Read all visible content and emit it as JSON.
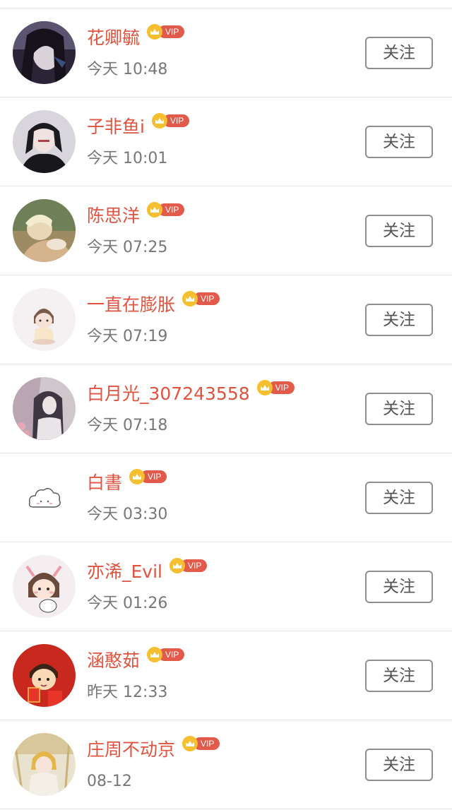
{
  "users": [
    {
      "name": "花卿毓",
      "vip_label": "VIP",
      "time": "今天 10:48",
      "follow_label": "关注"
    },
    {
      "name": "子非鱼i",
      "vip_label": "VIP",
      "time": "今天 10:01",
      "follow_label": "关注"
    },
    {
      "name": "陈思洋",
      "vip_label": "VIP",
      "time": "今天 07:25",
      "follow_label": "关注"
    },
    {
      "name": "一直在膨胀",
      "vip_label": "VIP",
      "time": "今天 07:19",
      "follow_label": "关注"
    },
    {
      "name": "白月光_307243558",
      "vip_label": "VIP",
      "time": "今天 07:18",
      "follow_label": "关注"
    },
    {
      "name": "白書",
      "vip_label": "VIP",
      "time": "今天 03:30",
      "follow_label": "关注"
    },
    {
      "name": "亦浠_Evil",
      "vip_label": "VIP",
      "time": "今天 01:26",
      "follow_label": "关注"
    },
    {
      "name": "涵憨茹",
      "vip_label": "VIP",
      "time": "昨天 12:33",
      "follow_label": "关注"
    },
    {
      "name": "庄周不动京",
      "vip_label": "VIP",
      "time": "08-12",
      "follow_label": "关注"
    }
  ],
  "colors": {
    "name": "#e0533e",
    "vip_crown": "#f5bf2f",
    "vip_pill": "#e25a4a",
    "time": "#777777",
    "button_border": "#8f8f8f"
  }
}
